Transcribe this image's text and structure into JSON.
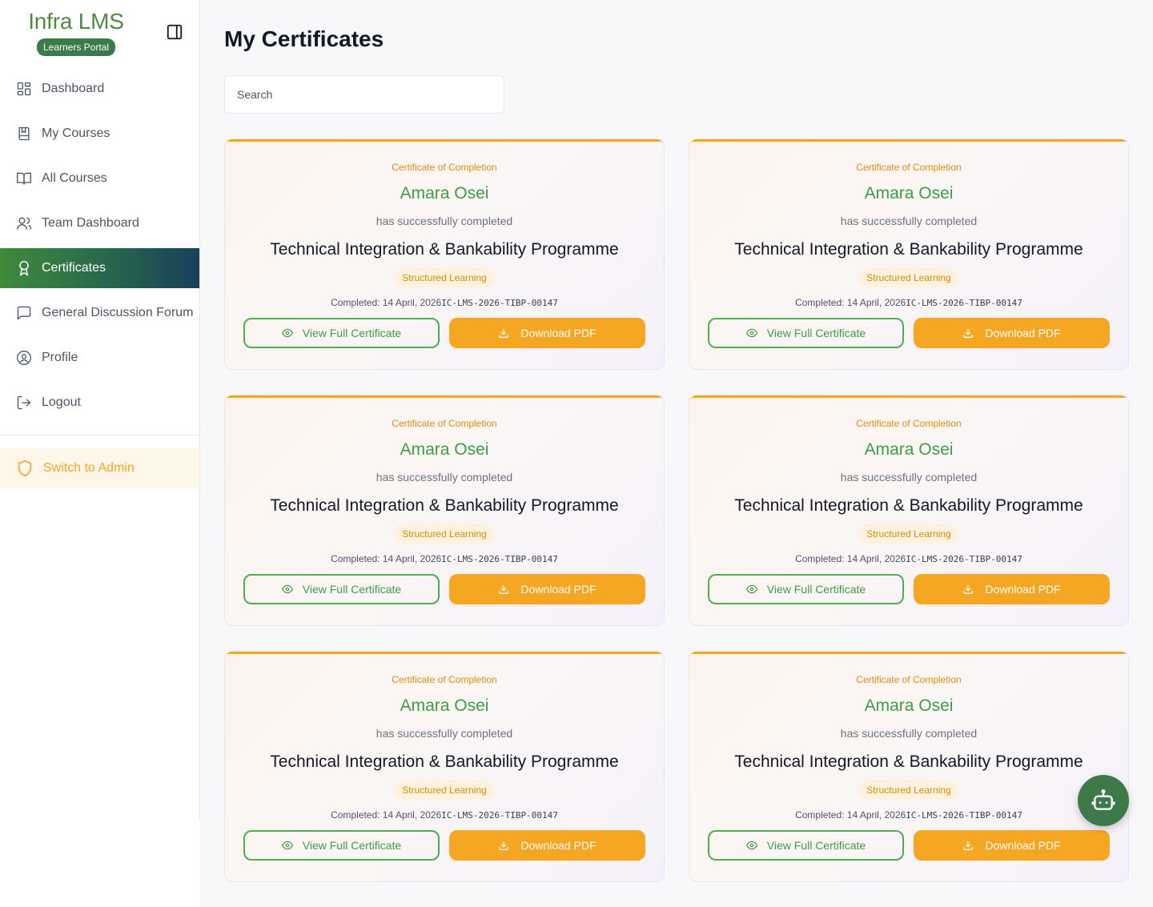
{
  "brand": {
    "title": "Infra LMS",
    "badge": "Learners Portal"
  },
  "nav": {
    "items": [
      {
        "label": "Dashboard",
        "icon": "dashboard-icon"
      },
      {
        "label": "My Courses",
        "icon": "book-icon"
      },
      {
        "label": "All Courses",
        "icon": "open-book-icon"
      },
      {
        "label": "Team Dashboard",
        "icon": "users-icon"
      },
      {
        "label": "Certificates",
        "icon": "award-icon",
        "active": true
      },
      {
        "label": "General Discussion Forum",
        "icon": "chat-icon"
      },
      {
        "label": "Profile",
        "icon": "user-circle-icon"
      },
      {
        "label": "Logout",
        "icon": "logout-icon"
      }
    ],
    "switch_admin": "Switch to Admin"
  },
  "page": {
    "title": "My Certificates",
    "search_placeholder": "Search"
  },
  "certificates": [
    {
      "label": "Certificate of Completion",
      "name": "Amara Osei",
      "sub": "has successfully completed",
      "course": "Technical Integration & Bankability Programme",
      "tag": "Structured Learning",
      "completed": "Completed: 14 April, 2026",
      "code": "IC-LMS-2026-TIBP-00147",
      "view_label": "View Full Certificate",
      "download_label": "Download PDF"
    },
    {
      "label": "Certificate of Completion",
      "name": "Amara Osei",
      "sub": "has successfully completed",
      "course": "Technical Integration & Bankability Programme",
      "tag": "Structured Learning",
      "completed": "Completed: 14 April, 2026",
      "code": "IC-LMS-2026-TIBP-00147",
      "view_label": "View Full Certificate",
      "download_label": "Download PDF"
    },
    {
      "label": "Certificate of Completion",
      "name": "Amara Osei",
      "sub": "has successfully completed",
      "course": "Technical Integration & Bankability Programme",
      "tag": "Structured Learning",
      "completed": "Completed: 14 April, 2026",
      "code": "IC-LMS-2026-TIBP-00147",
      "view_label": "View Full Certificate",
      "download_label": "Download PDF"
    },
    {
      "label": "Certificate of Completion",
      "name": "Amara Osei",
      "sub": "has successfully completed",
      "course": "Technical Integration & Bankability Programme",
      "tag": "Structured Learning",
      "completed": "Completed: 14 April, 2026",
      "code": "IC-LMS-2026-TIBP-00147",
      "view_label": "View Full Certificate",
      "download_label": "Download PDF"
    },
    {
      "label": "Certificate of Completion",
      "name": "Amara Osei",
      "sub": "has successfully completed",
      "course": "Technical Integration & Bankability Programme",
      "tag": "Structured Learning",
      "completed": "Completed: 14 April, 2026",
      "code": "IC-LMS-2026-TIBP-00147",
      "view_label": "View Full Certificate",
      "download_label": "Download PDF"
    },
    {
      "label": "Certificate of Completion",
      "name": "Amara Osei",
      "sub": "has successfully completed",
      "course": "Technical Integration & Bankability Programme",
      "tag": "Structured Learning",
      "completed": "Completed: 14 April, 2026",
      "code": "IC-LMS-2026-TIBP-00147",
      "view_label": "View Full Certificate",
      "download_label": "Download PDF"
    }
  ],
  "colors": {
    "brand_green": "#3d7a4a",
    "accent_orange": "#f5a623",
    "name_green": "#3e9c48"
  }
}
